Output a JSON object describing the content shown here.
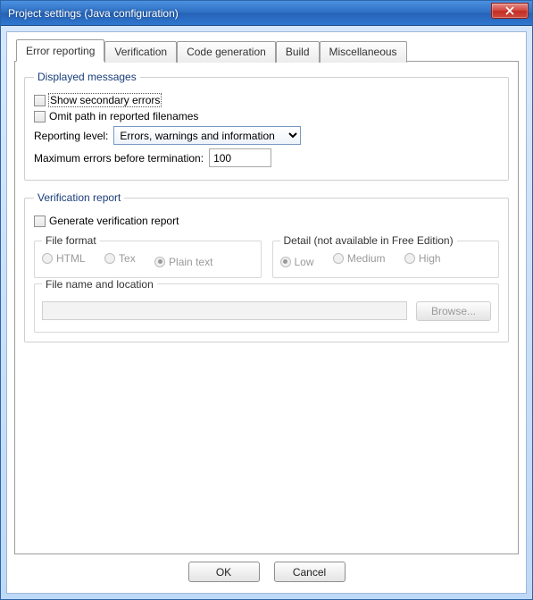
{
  "window": {
    "title": "Project settings (Java configuration)"
  },
  "tabs": [
    {
      "label": "Error reporting"
    },
    {
      "label": "Verification"
    },
    {
      "label": "Code generation"
    },
    {
      "label": "Build"
    },
    {
      "label": "Miscellaneous"
    }
  ],
  "displayed": {
    "legend": "Displayed messages",
    "show_secondary": "Show secondary errors",
    "omit_path": "Omit path in reported filenames",
    "reporting_level_label": "Reporting level:",
    "reporting_level_value": "Errors, warnings and information",
    "max_errors_label": "Maximum errors before termination:",
    "max_errors_value": "100"
  },
  "verification": {
    "legend": "Verification report",
    "generate_label": "Generate verification report",
    "file_format": {
      "legend": "File format",
      "html": "HTML",
      "tex": "Tex",
      "plain": "Plain text"
    },
    "detail": {
      "legend": "Detail (not available in Free Edition)",
      "low": "Low",
      "medium": "Medium",
      "high": "High"
    },
    "file_loc": {
      "legend": "File name and location",
      "browse": "Browse..."
    }
  },
  "buttons": {
    "ok": "OK",
    "cancel": "Cancel"
  }
}
